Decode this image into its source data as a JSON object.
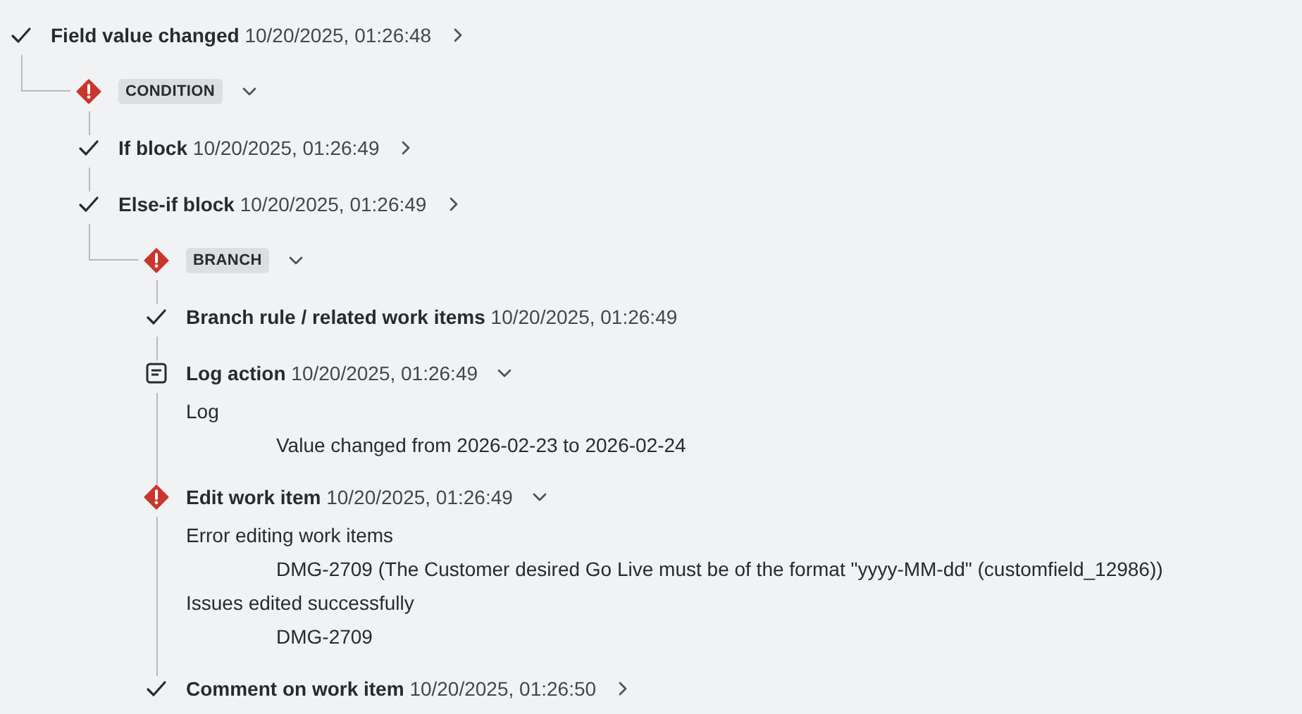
{
  "steps": [
    {
      "kind": "success",
      "title": "Field value changed",
      "time": "10/20/2025, 01:26:48",
      "expanded": false,
      "children": [
        {
          "kind": "error",
          "tag": "CONDITION",
          "expanded": true,
          "children": [
            {
              "kind": "success",
              "title": "If block",
              "time": "10/20/2025, 01:26:49",
              "expanded": false
            },
            {
              "kind": "success",
              "title": "Else-if block",
              "time": "10/20/2025, 01:26:49",
              "expanded": false,
              "children": [
                {
                  "kind": "error",
                  "tag": "BRANCH",
                  "expanded": true,
                  "children": [
                    {
                      "kind": "success",
                      "title": "Branch rule / related work items",
                      "time": "10/20/2025, 01:26:49"
                    },
                    {
                      "kind": "log",
                      "title": "Log action",
                      "time": "10/20/2025, 01:26:49",
                      "expanded": true,
                      "details": [
                        {
                          "heading": "Log",
                          "items": [
                            "Value changed from 2026-02-23 to 2026-02-24"
                          ]
                        }
                      ]
                    },
                    {
                      "kind": "error",
                      "title": "Edit work item",
                      "time": "10/20/2025, 01:26:49",
                      "expanded": true,
                      "details": [
                        {
                          "heading": "Error editing work items",
                          "items": [
                            "DMG-2709 (The Customer desired Go Live must be of the format \"yyyy-MM-dd\" (customfield_12986))"
                          ]
                        },
                        {
                          "heading": "Issues edited successfully",
                          "items": [
                            "DMG-2709"
                          ]
                        }
                      ]
                    },
                    {
                      "kind": "success",
                      "title": "Comment on work item",
                      "time": "10/20/2025, 01:26:50",
                      "expanded": false
                    }
                  ]
                }
              ]
            }
          ]
        }
      ]
    }
  ]
}
